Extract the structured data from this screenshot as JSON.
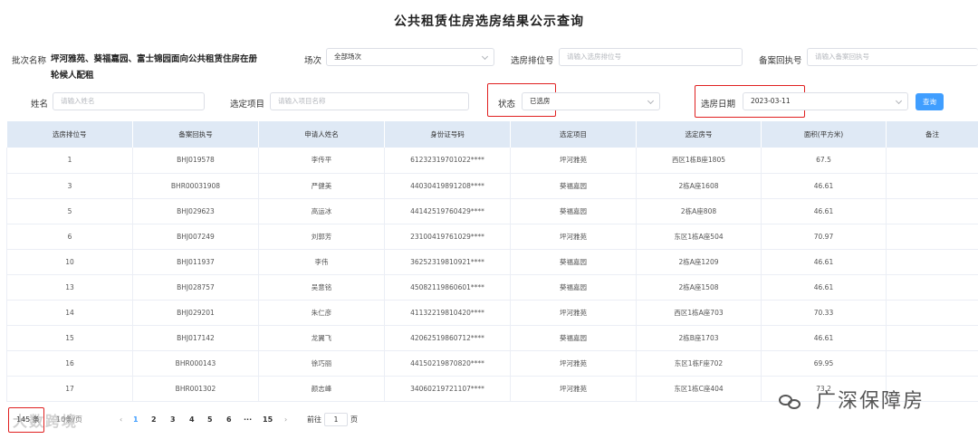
{
  "title": "公共租赁住房选房结果公示查询",
  "filters": {
    "batch_label": "批次名称",
    "batch_value": "坪河雅苑、葵福嘉园、富士锦园面向公共租赁住房在册轮候人配租",
    "session_label": "场次",
    "session_value": "全部场次",
    "rank_label": "选房排位号",
    "rank_placeholder": "请输入选房排位号",
    "record_label": "备案回执号",
    "record_placeholder": "请输入备案回执号",
    "name_label": "姓名",
    "name_placeholder": "请输入姓名",
    "project_label": "选定项目",
    "project_placeholder": "请输入项目名称",
    "status_label": "状态",
    "status_value": "已选房",
    "date_label": "选房日期",
    "date_value": "2023-03-11",
    "query_button": "查询"
  },
  "table": {
    "headers": [
      "选房排位号",
      "备案回执号",
      "申请人姓名",
      "身份证号码",
      "选定项目",
      "选定房号",
      "面积(平方米)",
      "备注"
    ],
    "rows": [
      [
        "1",
        "BHJ019578",
        "李传平",
        "61232319701022****",
        "坪河雅苑",
        "西区1栋B座1805",
        "67.5",
        ""
      ],
      [
        "3",
        "BHR00031908",
        "严健美",
        "44030419891208****",
        "葵福嘉园",
        "2栋A座1608",
        "46.61",
        ""
      ],
      [
        "5",
        "BHJ029623",
        "高运冰",
        "44142519760429****",
        "葵福嘉园",
        "2栋A座808",
        "46.61",
        ""
      ],
      [
        "6",
        "BHJ007249",
        "刘郭芳",
        "23100419761029****",
        "坪河雅苑",
        "东区1栋A座504",
        "70.97",
        ""
      ],
      [
        "10",
        "BHJ011937",
        "李伟",
        "36252319810921****",
        "葵福嘉园",
        "2栋A座1209",
        "46.61",
        ""
      ],
      [
        "13",
        "BHJ028757",
        "吴意铭",
        "45082119860601****",
        "葵福嘉园",
        "2栋A座1508",
        "46.61",
        ""
      ],
      [
        "14",
        "BHJ029201",
        "朱仁彦",
        "41132219810420****",
        "坪河雅苑",
        "西区1栋A座703",
        "70.33",
        ""
      ],
      [
        "15",
        "BHJ017142",
        "龙翼飞",
        "42062519860712****",
        "葵福嘉园",
        "2栋B座1703",
        "46.61",
        ""
      ],
      [
        "16",
        "BHR000143",
        "徐巧丽",
        "44150219870820****",
        "坪河雅苑",
        "东区1栋F座702",
        "69.95",
        ""
      ],
      [
        "17",
        "BHR001302",
        "颜志峰",
        "34060219721107****",
        "坪河雅苑",
        "东区1栋C座404",
        "73.2",
        ""
      ]
    ]
  },
  "pagination": {
    "total": "145 条",
    "page_size": "10条/页",
    "pages": [
      "1",
      "2",
      "3",
      "4",
      "5",
      "6",
      "···",
      "15"
    ],
    "prev": "‹",
    "next": "›",
    "goto_label": "前往",
    "goto_value": "1",
    "goto_suffix": "页"
  },
  "watermarks": {
    "left": "大数跨境",
    "right": "广深保障房"
  },
  "colors": {
    "header_bg": "#dfe9f5",
    "primary": "#409eff",
    "highlight_box": "#e02020"
  }
}
